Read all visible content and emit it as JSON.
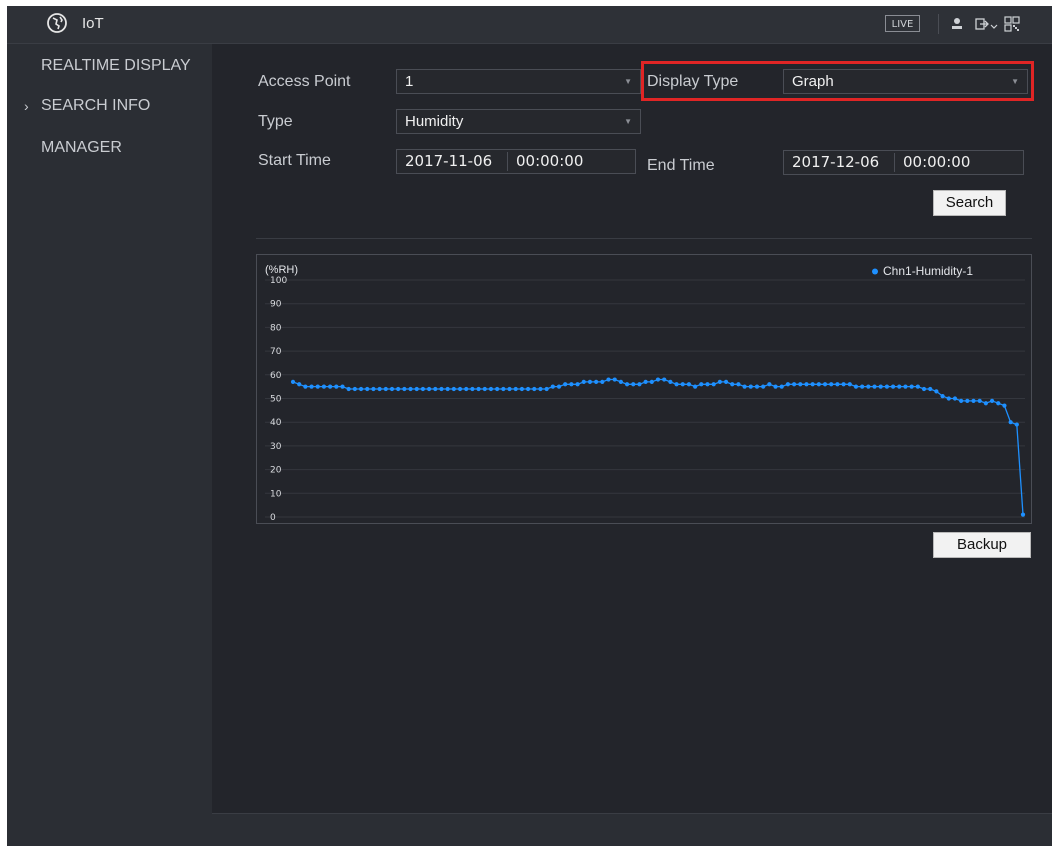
{
  "app": {
    "title": "IoT"
  },
  "topbar": {
    "live_label": "LIVE",
    "icons": [
      "user-icon",
      "logout-icon",
      "qr-code-icon"
    ]
  },
  "sidebar": {
    "items": [
      {
        "label": "REALTIME DISPLAY",
        "active": false
      },
      {
        "label": "SEARCH INFO",
        "active": true
      },
      {
        "label": "MANAGER",
        "active": false
      }
    ]
  },
  "form": {
    "access_point": {
      "label": "Access Point",
      "value": "1"
    },
    "display_type": {
      "label": "Display Type",
      "value": "Graph"
    },
    "type": {
      "label": "Type",
      "value": "Humidity"
    },
    "start_time": {
      "label": "Start Time",
      "date": "2017-11-06",
      "time": "00:00:00"
    },
    "end_time": {
      "label": "End Time",
      "date": "2017-12-06",
      "time": "00:00:00"
    },
    "search_label": "Search",
    "backup_label": "Backup"
  },
  "colors": {
    "series": "#1e90ff",
    "highlight": "#e02525",
    "background": "#23252b"
  },
  "chart_data": {
    "type": "line",
    "ylabel": "(%RH)",
    "ylim": [
      0,
      100
    ],
    "yticks": [
      100,
      90,
      80,
      70,
      60,
      50,
      40,
      30,
      20,
      10,
      0
    ],
    "grid": true,
    "legend_position": "top-right",
    "series": [
      {
        "name": "Chn1-Humidity-1",
        "color": "#1e90ff",
        "values": [
          57,
          56,
          55,
          55,
          55,
          55,
          55,
          55,
          55,
          54,
          54,
          54,
          54,
          54,
          54,
          54,
          54,
          54,
          54,
          54,
          54,
          54,
          54,
          54,
          54,
          54,
          54,
          54,
          54,
          54,
          54,
          54,
          54,
          54,
          54,
          54,
          54,
          54,
          54,
          54,
          54,
          54,
          55,
          55,
          56,
          56,
          56,
          57,
          57,
          57,
          57,
          58,
          58,
          57,
          56,
          56,
          56,
          57,
          57,
          58,
          58,
          57,
          56,
          56,
          56,
          55,
          56,
          56,
          56,
          57,
          57,
          56,
          56,
          55,
          55,
          55,
          55,
          56,
          55,
          55,
          56,
          56,
          56,
          56,
          56,
          56,
          56,
          56,
          56,
          56,
          56,
          55,
          55,
          55,
          55,
          55,
          55,
          55,
          55,
          55,
          55,
          55,
          54,
          54,
          53,
          51,
          50,
          50,
          49,
          49,
          49,
          49,
          48,
          49,
          48,
          47,
          40,
          39,
          1
        ]
      }
    ]
  }
}
